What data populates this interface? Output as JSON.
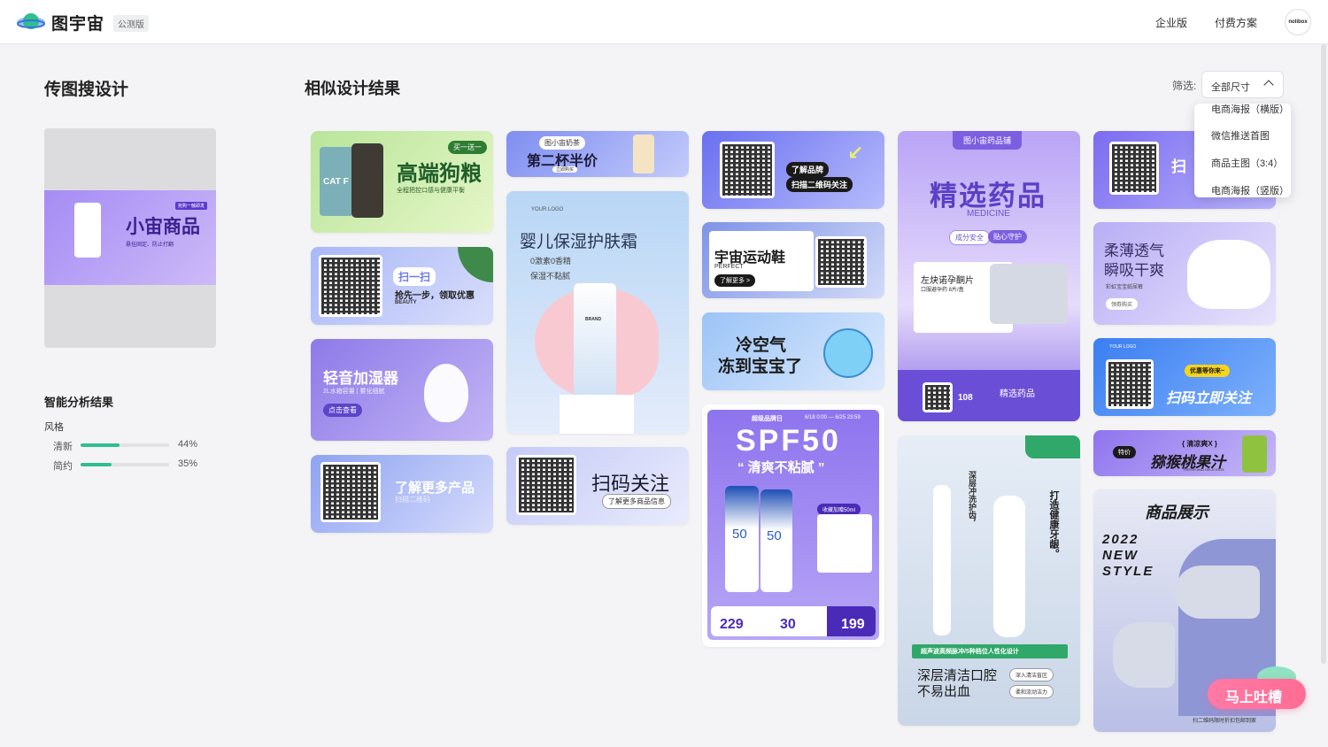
{
  "header": {
    "app_name": "图宇宙",
    "badge": "公测版",
    "nav_enterprise": "企业版",
    "nav_pricing": "付费方案",
    "avatar_text": "nolibox"
  },
  "sidebar": {
    "title": "传图搜设计",
    "preview": {
      "tag": "抢购一触即发",
      "headline": "小宙商品",
      "sub": "悬挂固定、防止打翻"
    },
    "analysis_title": "智能分析结果",
    "style_label": "风格",
    "styles": [
      {
        "name": "清新",
        "pct": "44%",
        "value": 0.44
      },
      {
        "name": "简约",
        "pct": "35%",
        "value": 0.35
      }
    ]
  },
  "main": {
    "title": "相似设计结果",
    "filter_label": "筛选:",
    "filter_value": "全部尺寸",
    "filter_options": [
      "电商海报（横版）",
      "微信推送首图",
      "商品主图（3:4）",
      "电商海报（竖版）"
    ]
  },
  "cards": {
    "c1": {
      "tag": "买一送一",
      "title": "高端狗粮",
      "sub": "全程把控口感与健康平衡",
      "bag": "CAT F"
    },
    "c2": {
      "title": "扫一扫",
      "sub": "抢先一步，领取优惠",
      "en": "BEAUTY"
    },
    "c3": {
      "title": "轻音加湿器",
      "sub": "2L水箱容量 | 雾化细腻",
      "btn": "点击查看"
    },
    "c4": {
      "title": "了解更多产品",
      "sub": "扫描二维码"
    },
    "c5": {
      "brand": "图小宙奶茶",
      "title": "第二杯半价",
      "btn": "立即购买"
    },
    "c6": {
      "logo": "YOUR LOGO",
      "title": "婴儿保湿护肤霜",
      "f1": "0激素0香精",
      "f2": "保湿不黏腻",
      "brand": "BRAND"
    },
    "c7": {
      "title": "扫码关注",
      "sub": "了解更多商品信息"
    },
    "c8": {
      "b1": "了解品牌",
      "b2": "扫描二维码关注"
    },
    "c9": {
      "title": "宇宙运动鞋",
      "en": "PERFECT",
      "btn": "了解更多 >"
    },
    "c10": {
      "l1": "冷空气",
      "l2": "冻到宝宝了"
    },
    "c11": {
      "tag": "超级品牌日",
      "date": "6/18 0:00 — 6/25 23:59",
      "title": "SPF50",
      "sub": "“ 清爽不粘腻 ”",
      "gift": "收藏加赠50ml",
      "p1": "229",
      "p2": "30",
      "p3": "199",
      "bottle": "50"
    },
    "c12": {
      "brand": "图小宙药品铺",
      "title": "精选药品",
      "en": "MEDICINE",
      "t1": "成分安全",
      "t2": "贴心守护",
      "drug": "左炔诺孕酮片",
      "dose": "口服避孕药  8片/盒",
      "footer_title": "精选药品",
      "price": "108"
    },
    "c13": {
      "vert1": "深层冲洗护齿，",
      "vert2": "打造健康牙龈。",
      "banner": "超声波高频脉冲/5种档位人性化设计",
      "l1": "深层清洁口腔",
      "l2": "不易出血",
      "p1": "深入清洁盲区",
      "p2": "柔和流动洁力"
    },
    "c14": {
      "text": "扫"
    },
    "c15": {
      "l1": "柔薄透气",
      "l2": "瞬吸干爽",
      "sub": "彩虹宝宝纸尿裤",
      "btn": "领券购买"
    },
    "c16": {
      "logo": "YOUR LOGO",
      "tag": "优惠等你来~",
      "title": "扫码立即关注"
    },
    "c17": {
      "tag": "特价",
      "title": "猕猴桃果汁",
      "sub": "{ 清凉爽X }",
      "en": "FRESH AND DELICIOUS"
    },
    "c18": {
      "title": "商品展示",
      "year": "2022",
      "l2": "NEW",
      "l3": "STYLE",
      "foot": "扫二维码限时折扣包邮到家"
    }
  },
  "feedback": {
    "label": "马上吐槽"
  }
}
